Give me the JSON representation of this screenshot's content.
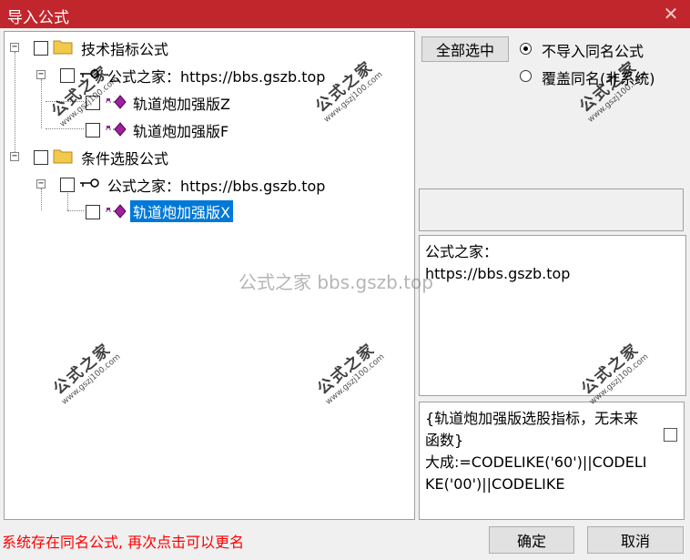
{
  "window": {
    "title": "导入公式",
    "close_glyph": "✕"
  },
  "tree": {
    "nodes": [
      {
        "label": "技术指标公式",
        "icon": "folder-icon",
        "expander": "−"
      },
      {
        "label": "公式之家：https://bbs.gszb.top",
        "icon": "key-icon",
        "expander": "−"
      },
      {
        "label": "轨道炮加强版Z",
        "icon": "formula-icon"
      },
      {
        "label": "轨道炮加强版F",
        "icon": "formula-icon"
      },
      {
        "label": "条件选股公式",
        "icon": "folder-icon",
        "expander": "−"
      },
      {
        "label": "公式之家：https://bbs.gszb.top",
        "icon": "key-icon",
        "expander": "−"
      },
      {
        "label": "轨道炮加强版X",
        "icon": "formula-icon",
        "selected": true
      }
    ]
  },
  "options": {
    "select_all_label": "全部选中",
    "radio_no_import": "不导入同名公式",
    "radio_overwrite": "覆盖同名(非系统)",
    "selected_radio": "no_import"
  },
  "description": {
    "line1": "公式之家：",
    "line2": "https://bbs.gszb.top"
  },
  "code": {
    "text": "{轨道炮加强版选股指标，无未来函数}\n大成:=CODELIKE('60')||CODELIKE('00')||CODELIKE"
  },
  "status": {
    "message": "系统存在同名公式, 再次点击可以更名"
  },
  "buttons": {
    "ok_label": "确定",
    "cancel_label": "取消"
  },
  "watermark": {
    "center_text": "公式之家 bbs.gszb.top",
    "stamp_cn": "公式之家",
    "stamp_url": "www.gszj100.com"
  },
  "colors": {
    "titlebar": "#c0262c",
    "selection": "#0078d7",
    "status_text": "#ff0000",
    "folder": "#f2c94c",
    "formula_icon": "#a020a0"
  }
}
